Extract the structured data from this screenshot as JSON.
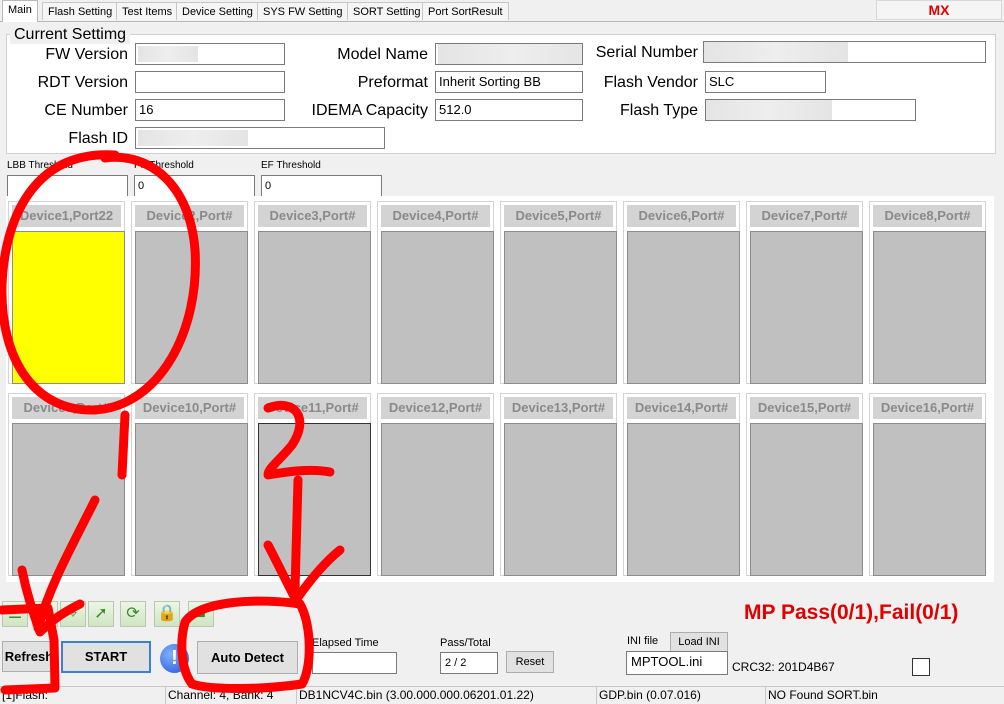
{
  "tabs": [
    {
      "label": "Main",
      "active": true
    },
    {
      "label": "Flash Setting"
    },
    {
      "label": "Test Items"
    },
    {
      "label": "Device Setting"
    },
    {
      "label": "SYS FW Setting"
    },
    {
      "label": "SORT Setting"
    },
    {
      "label": "Port SortResult"
    }
  ],
  "brand": "MX",
  "current_setting": {
    "title": "Current Settimg",
    "fw_version_label": "FW Version",
    "rdt_version_label": "RDT Version",
    "rdt_version": "",
    "ce_number_label": "CE Number",
    "ce_number": "16",
    "flash_id_label": "Flash ID",
    "model_name_label": "Model Name",
    "preformat_label": "Preformat",
    "preformat": "Inherit Sorting BB",
    "idema_label": "IDEMA Capacity",
    "idema": "512.0",
    "serial_label": "Serial Number",
    "flash_vendor_label": "Flash Vendor",
    "flash_vendor": "SLC",
    "flash_type_label": "Flash Type"
  },
  "thresholds": {
    "lbb_label": "LBB Threshold",
    "lbb": "",
    "pf_label": "PF Threshold",
    "pf": "0",
    "ef_label": "EF Threshold",
    "ef": "0"
  },
  "devices": [
    "Device1,Port22",
    "Device2,Port#",
    "Device3,Port#",
    "Device4,Port#",
    "Device5,Port#",
    "Device6,Port#",
    "Device7,Port#",
    "Device8,Port#",
    "Device9,Port#",
    "Device10,Port#",
    "Device11,Port#",
    "Device12,Port#",
    "Device13,Port#",
    "Device14,Port#",
    "Device15,Port#",
    "Device16,Port#"
  ],
  "device_states": {
    "active": [
      0
    ],
    "selected": [
      10
    ]
  },
  "device_colors": {
    "active": "#ffff00",
    "idle": "#c0c0c0"
  },
  "toolbar_icons": [
    "list-icon",
    "check-icon",
    "pin-icon",
    "cursor-icon",
    "refresh-icon",
    "lock-icon",
    "stop-icon"
  ],
  "result_text": "MP  Pass(0/1),Fail(0/1)",
  "controls": {
    "refresh": "Refresh",
    "start": "START",
    "info_glyph": "!",
    "auto_detect": "Auto Detect",
    "elapsed_label": "Elapsed Time",
    "elapsed": "",
    "pass_total_label": "Pass/Total",
    "pass_total": "2 / 2",
    "reset": "Reset",
    "ini_label": "INI file",
    "load_ini": "Load INI",
    "ini_file": "MPTOOL.ini",
    "crc": "CRC32: 201D4B67"
  },
  "status": [
    "[1]Flash:",
    "Channel: 4, Bank: 4",
    "DB1NCV4C.bin (3.00.000.000.06201.01.22)",
    "GDP.bin (0.07.016)",
    "NO Found SORT.bin"
  ],
  "annotation": {
    "color": "#ff0000",
    "labels": [
      "1",
      "2"
    ]
  }
}
